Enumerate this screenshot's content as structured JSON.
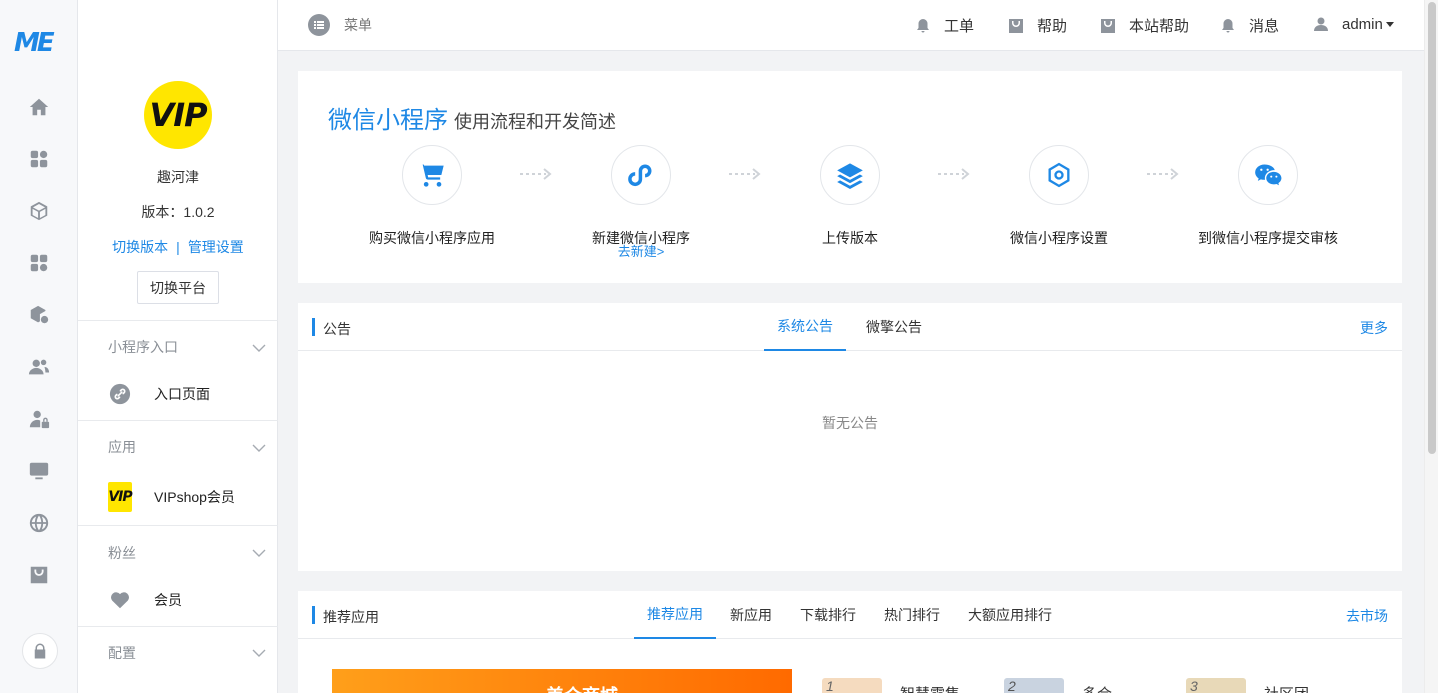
{
  "brand": {
    "logo_text": "ME",
    "accent": "#1e88e5"
  },
  "rail": {
    "icons": [
      "home-icon",
      "apps-grid-icon",
      "cube-icon",
      "app-settings-icon",
      "box-settings-icon",
      "users-icon",
      "user-lock-icon",
      "monitor-icon",
      "globe-icon",
      "bag-icon"
    ],
    "lock_icon": "lock-icon"
  },
  "sidebar": {
    "avatar_text": "VIP",
    "account_name": "趣河津",
    "version": "版本：1.0.2",
    "switch_version": "切换版本",
    "link_separator": "|",
    "manage_settings": "管理设置",
    "switch_platform": "切换平台",
    "groups": [
      {
        "title": "小程序入口",
        "items": [
          {
            "label": "入口页面",
            "icon": "link-icon"
          }
        ]
      },
      {
        "title": "应用",
        "items": [
          {
            "label": "VIPshop会员",
            "icon": "vip-app-icon",
            "badge_text": "VIP"
          }
        ]
      },
      {
        "title": "粉丝",
        "items": [
          {
            "label": "会员",
            "icon": "heart-icon"
          }
        ]
      },
      {
        "title": "配置",
        "items": []
      }
    ]
  },
  "topbar": {
    "menu_label": "菜单",
    "items": [
      {
        "label": "工单",
        "icon": "bell-icon"
      },
      {
        "label": "帮助",
        "icon": "bag-icon"
      },
      {
        "label": "本站帮助",
        "icon": "bag-icon"
      },
      {
        "label": "消息",
        "icon": "bell-icon"
      }
    ],
    "user": "admin"
  },
  "intro": {
    "title": "微信小程序",
    "subtitle": "使用流程和开发简述",
    "steps": [
      {
        "label": "购买微信小程序应用",
        "icon": "cart-icon"
      },
      {
        "label": "新建微信小程序",
        "icon": "miniprogram-icon",
        "link": "去新建>"
      },
      {
        "label": "上传版本",
        "icon": "layers-icon"
      },
      {
        "label": "微信小程序设置",
        "icon": "hexagon-settings-icon"
      },
      {
        "label": "到微信小程序提交审核",
        "icon": "wechat-icon"
      }
    ]
  },
  "notice": {
    "title": "公告",
    "tabs": [
      "系统公告",
      "微擎公告"
    ],
    "active_tab": "系统公告",
    "more": "更多",
    "empty_text": "暂无公告"
  },
  "recommend": {
    "title": "推荐应用",
    "tabs": [
      "推荐应用",
      "新应用",
      "下载排行",
      "热门排行",
      "大额应用排行"
    ],
    "active_tab": "推荐应用",
    "market_link": "去市场",
    "banner_text": "美介商城",
    "ranked": [
      {
        "rank": "1",
        "name": "智慧零售"
      },
      {
        "rank": "2",
        "name": "多合"
      },
      {
        "rank": "3",
        "name": "社区团"
      }
    ]
  }
}
